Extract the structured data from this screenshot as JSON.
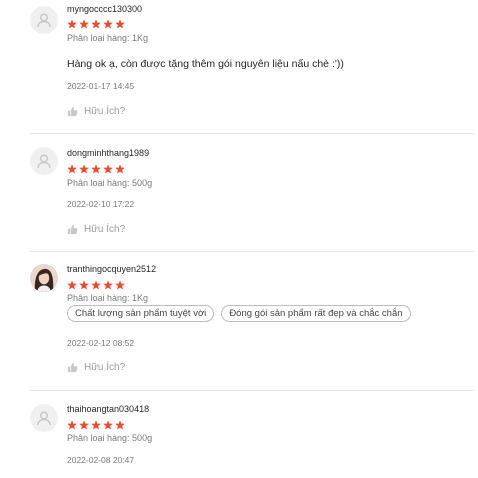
{
  "colors": {
    "star": "#ee4d2d",
    "muted": "#757575",
    "divider": "#e8e8e8"
  },
  "helpful_label": "Hữu Ích?",
  "reviews": [
    {
      "username": "myngocccc130300",
      "rating": 5,
      "variation": "Phân loại hàng: 1Kg",
      "comment": "Hàng ok ạ, còn được tặng thêm gói nguyên liệu nấu chè :'))",
      "date": "2022-01-17 14:45"
    },
    {
      "username": "dongminhthang1989",
      "rating": 5,
      "variation": "Phân loại hàng: 500g",
      "date": "2022-02-10 17:22"
    },
    {
      "username": "tranthingocquyen2512",
      "rating": 5,
      "variation": "Phân loại hàng: 1Kg",
      "tags": [
        "Chất lượng sản phẩm tuyệt vời",
        "Đóng gói sản phẩm rất đẹp và chắc chắn"
      ],
      "date": "2022-02-12 08:52"
    },
    {
      "username": "thaihoangtan030418",
      "rating": 5,
      "variation": "Phân loại hàng: 500g",
      "date": "2022-02-08 20:47"
    }
  ]
}
